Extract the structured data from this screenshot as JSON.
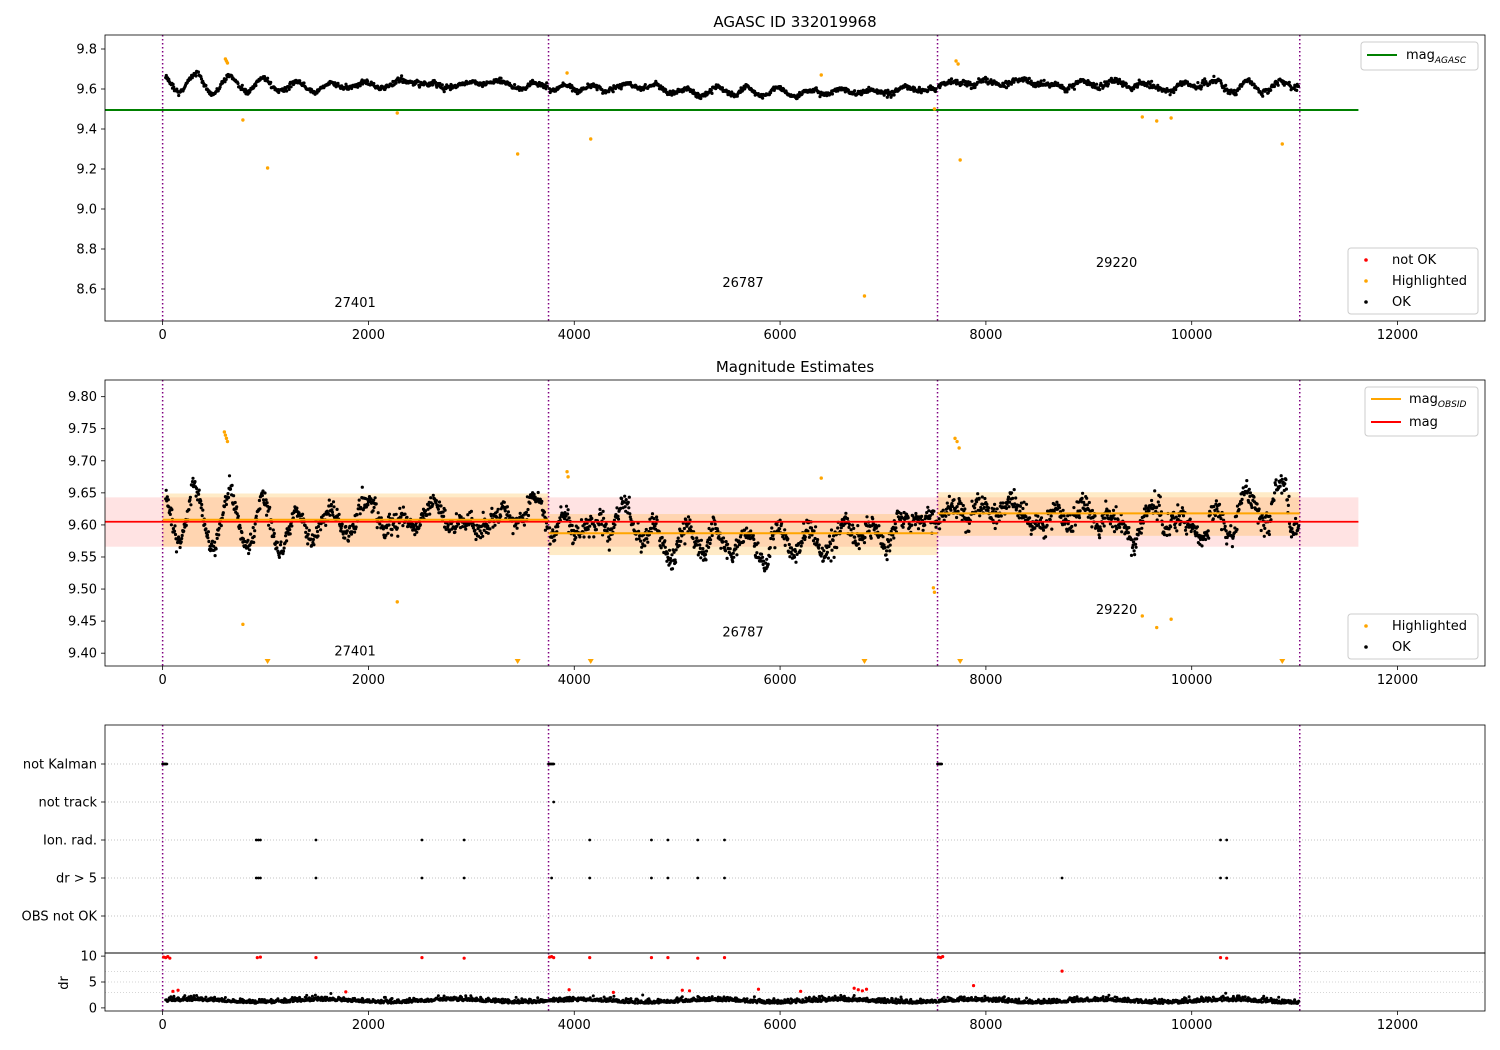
{
  "figure": {
    "background": "#ffffff"
  },
  "chart_data": [
    {
      "id": "agasc",
      "type": "scatter",
      "title": "AGASC ID 332019968",
      "xlim": [
        -560,
        12850
      ],
      "ylim": [
        8.44,
        9.87
      ],
      "xticks": [
        0,
        2000,
        4000,
        6000,
        8000,
        10000,
        12000
      ],
      "yticks": [
        8.6,
        8.8,
        9.0,
        9.2,
        9.4,
        9.6,
        9.8
      ],
      "ytick_labels": [
        "8.6",
        "8.8",
        "9.0",
        "9.2",
        "9.4",
        "9.6",
        "9.8"
      ],
      "grid": false,
      "obs_boundaries": [
        0,
        3750,
        7530,
        11050
      ],
      "obs_labels": [
        {
          "text": "27401",
          "x": 1870,
          "y": 8.51
        },
        {
          "text": "26787",
          "x": 5640,
          "y": 8.61
        },
        {
          "text": "29220",
          "x": 9270,
          "y": 8.71
        }
      ],
      "reference_lines": [
        {
          "name": "mag",
          "sub": "AGASC",
          "y": 9.495,
          "x0": -560,
          "x1": 11620,
          "color": "#008000"
        }
      ],
      "ok_series": {
        "name": "OK",
        "color": "#000000",
        "segments": [
          {
            "x0": 30,
            "x1": 3740,
            "base": 9.62,
            "amp": 0.05,
            "noise": 0.012,
            "period": 330
          },
          {
            "x0": 3760,
            "x1": 7520,
            "base": 9.595,
            "amp": 0.02,
            "noise": 0.012,
            "period": 300
          },
          {
            "x0": 7540,
            "x1": 11040,
            "base": 9.625,
            "amp": 0.025,
            "noise": 0.015,
            "period": 320
          }
        ]
      },
      "highlighted": {
        "name": "Highlighted",
        "color": "#ffa500",
        "points": [
          [
            610,
            9.75
          ],
          [
            620,
            9.74
          ],
          [
            630,
            9.73
          ],
          [
            780,
            9.445
          ],
          [
            1020,
            9.205
          ],
          [
            2280,
            9.48
          ],
          [
            3450,
            9.275
          ],
          [
            3930,
            9.68
          ],
          [
            4160,
            9.35
          ],
          [
            6400,
            9.67
          ],
          [
            6820,
            8.565
          ],
          [
            7500,
            9.5
          ],
          [
            7710,
            9.74
          ],
          [
            7730,
            9.725
          ],
          [
            7750,
            9.245
          ],
          [
            9520,
            9.46
          ],
          [
            9660,
            9.44
          ],
          [
            9800,
            9.455
          ],
          [
            10880,
            9.325
          ]
        ]
      },
      "not_ok": {
        "name": "not OK",
        "color": "#ff0000",
        "points": []
      },
      "legends": [
        {
          "position": "upper right",
          "entries": [
            {
              "kind": "line",
              "color": "#008000",
              "label": "mag",
              "sub": "AGASC"
            }
          ]
        },
        {
          "position": "lower right",
          "entries": [
            {
              "kind": "dot",
              "color": "#ff0000",
              "label": "not OK"
            },
            {
              "kind": "dot",
              "color": "#ffa500",
              "label": "Highlighted"
            },
            {
              "kind": "dot",
              "color": "#000000",
              "label": "OK"
            }
          ]
        }
      ]
    },
    {
      "id": "estimates",
      "type": "scatter",
      "title": "Magnitude Estimates",
      "xlim": [
        -560,
        12850
      ],
      "ylim": [
        9.38,
        9.826
      ],
      "xticks": [
        0,
        2000,
        4000,
        6000,
        8000,
        10000,
        12000
      ],
      "yticks": [
        9.4,
        9.45,
        9.5,
        9.55,
        9.6,
        9.65,
        9.7,
        9.75,
        9.8
      ],
      "ytick_labels": [
        "9.40",
        "9.45",
        "9.50",
        "9.55",
        "9.60",
        "9.65",
        "9.70",
        "9.75",
        "9.80"
      ],
      "grid": false,
      "obs_boundaries": [
        0,
        3750,
        7530,
        11050
      ],
      "obs_labels": [
        {
          "text": "27401",
          "x": 1870,
          "y": 9.396
        },
        {
          "text": "26787",
          "x": 5640,
          "y": 9.426
        },
        {
          "text": "29220",
          "x": 9270,
          "y": 9.461
        }
      ],
      "bands": [
        {
          "x0": -560,
          "x1": 11620,
          "y0": 9.566,
          "y1": 9.643,
          "color": "#ff0000",
          "opacity": 0.11
        },
        {
          "x0": 0,
          "x1": 3750,
          "y0": 9.566,
          "y1": 9.649,
          "color": "#ffa500",
          "opacity": 0.22
        },
        {
          "x0": 3750,
          "x1": 7530,
          "y0": 9.553,
          "y1": 9.617,
          "color": "#ffa500",
          "opacity": 0.22
        },
        {
          "x0": 7530,
          "x1": 11050,
          "y0": 9.583,
          "y1": 9.651,
          "color": "#ffa500",
          "opacity": 0.22
        }
      ],
      "obsid_mags": [
        {
          "x0": 0,
          "x1": 3750,
          "y": 9.608
        },
        {
          "x0": 3750,
          "x1": 7530,
          "y": 9.587
        },
        {
          "x0": 7530,
          "x1": 11050,
          "y": 9.618
        }
      ],
      "mag_line": {
        "y": 9.605,
        "x0": -560,
        "x1": 11620,
        "color": "#ff0000"
      },
      "ok_series": {
        "name": "OK",
        "color": "#000000",
        "segments": [
          {
            "x0": 30,
            "x1": 3740,
            "base": 9.605,
            "amp": 0.048,
            "noise": 0.014,
            "period": 330
          },
          {
            "x0": 3760,
            "x1": 7520,
            "base": 9.585,
            "amp": 0.022,
            "noise": 0.016,
            "period": 300
          },
          {
            "x0": 7540,
            "x1": 11040,
            "base": 9.615,
            "amp": 0.03,
            "noise": 0.017,
            "period": 320
          }
        ]
      },
      "highlighted": {
        "name": "Highlighted",
        "color": "#ffa500",
        "points": [
          [
            600,
            9.745
          ],
          [
            610,
            9.74
          ],
          [
            620,
            9.735
          ],
          [
            630,
            9.73
          ],
          [
            780,
            9.445
          ],
          [
            2280,
            9.48
          ],
          [
            3930,
            9.683
          ],
          [
            3940,
            9.675
          ],
          [
            6400,
            9.673
          ],
          [
            7500,
            9.495
          ],
          [
            7490,
            9.502
          ],
          [
            7700,
            9.735
          ],
          [
            7720,
            9.73
          ],
          [
            7740,
            9.72
          ],
          [
            9520,
            9.458
          ],
          [
            9660,
            9.44
          ],
          [
            9800,
            9.453
          ]
        ]
      },
      "below_axis_markers": {
        "color": "#ffa500",
        "x": [
          1020,
          3450,
          4160,
          6820,
          7750,
          10880
        ]
      },
      "legends": [
        {
          "position": "upper right",
          "entries": [
            {
              "kind": "line",
              "color": "#ffa500",
              "label": "mag",
              "sub": "OBSID"
            },
            {
              "kind": "line",
              "color": "#ff0000",
              "label": "mag",
              "sub": ""
            }
          ]
        },
        {
          "position": "lower right",
          "entries": [
            {
              "kind": "dot",
              "color": "#ffa500",
              "label": "Highlighted"
            },
            {
              "kind": "dot",
              "color": "#000000",
              "label": "OK"
            }
          ]
        }
      ]
    },
    {
      "id": "flags",
      "type": "scatter",
      "title": "",
      "xlim": [
        -560,
        12850
      ],
      "categories": [
        "not Kalman",
        "not track",
        "Ion. rad.",
        "dr > 5",
        "OBS not OK"
      ],
      "grid": true,
      "obs_boundaries": [
        0,
        3750,
        7530,
        11050
      ],
      "flag_points": {
        "not Kalman": [
          0,
          10,
          20,
          30,
          40,
          3750,
          3760,
          3770,
          3780,
          3790,
          3800,
          7530,
          7540,
          7550,
          7560,
          7570
        ],
        "not track": [
          3800
        ],
        "Ion. rad.": [
          910,
          930,
          950,
          1490,
          2520,
          2930,
          4150,
          4750,
          4910,
          5200,
          5460,
          10280,
          10340
        ],
        "dr > 5": [
          910,
          930,
          950,
          1490,
          2520,
          2930,
          3780,
          4150,
          4750,
          4910,
          5200,
          5460,
          8740,
          10280,
          10340
        ],
        "OBS not OK": []
      }
    },
    {
      "id": "dr",
      "type": "scatter",
      "title": "",
      "ylabel": "dr",
      "xlim": [
        -560,
        12850
      ],
      "ylim": [
        -0.6,
        10.6
      ],
      "xticks": [
        0,
        2000,
        4000,
        6000,
        8000,
        10000,
        12000
      ],
      "yticks": [
        0,
        5,
        10
      ],
      "grid_lines_y": [
        3,
        5,
        7
      ],
      "obs_boundaries": [
        0,
        3750,
        7530,
        11050
      ],
      "ok_series": {
        "name": "OK",
        "color": "#000000",
        "segments": [
          {
            "x0": 30,
            "x1": 3740,
            "base": 1.35,
            "amp": 0.25,
            "noise": 0.4,
            "period": 200
          },
          {
            "x0": 3760,
            "x1": 7520,
            "base": 1.3,
            "amp": 0.25,
            "noise": 0.4,
            "period": 200
          },
          {
            "x0": 7540,
            "x1": 11040,
            "base": 1.3,
            "amp": 0.25,
            "noise": 0.4,
            "period": 200
          }
        ]
      },
      "red_points": {
        "color": "#ff0000",
        "points": [
          [
            10,
            9.8
          ],
          [
            30,
            9.7
          ],
          [
            50,
            9.9
          ],
          [
            70,
            9.6
          ],
          [
            920,
            9.7
          ],
          [
            950,
            9.8
          ],
          [
            1490,
            9.7
          ],
          [
            2520,
            9.7
          ],
          [
            2930,
            9.6
          ],
          [
            3760,
            9.8
          ],
          [
            3780,
            9.9
          ],
          [
            3800,
            9.7
          ],
          [
            4150,
            9.7
          ],
          [
            4750,
            9.7
          ],
          [
            4910,
            9.7
          ],
          [
            5200,
            9.6
          ],
          [
            5460,
            9.7
          ],
          [
            7540,
            9.8
          ],
          [
            7560,
            9.7
          ],
          [
            7580,
            9.9
          ],
          [
            10280,
            9.7
          ],
          [
            10340,
            9.6
          ],
          [
            8740,
            7.1
          ],
          [
            7880,
            4.3
          ],
          [
            100,
            3.2
          ],
          [
            150,
            3.4
          ],
          [
            1780,
            3.1
          ],
          [
            3950,
            3.5
          ],
          [
            4380,
            3.0
          ],
          [
            5050,
            3.4
          ],
          [
            5120,
            3.3
          ],
          [
            5790,
            3.6
          ],
          [
            6200,
            3.2
          ],
          [
            6720,
            3.8
          ],
          [
            6760,
            3.5
          ],
          [
            6800,
            3.3
          ],
          [
            6840,
            3.6
          ]
        ]
      }
    }
  ]
}
